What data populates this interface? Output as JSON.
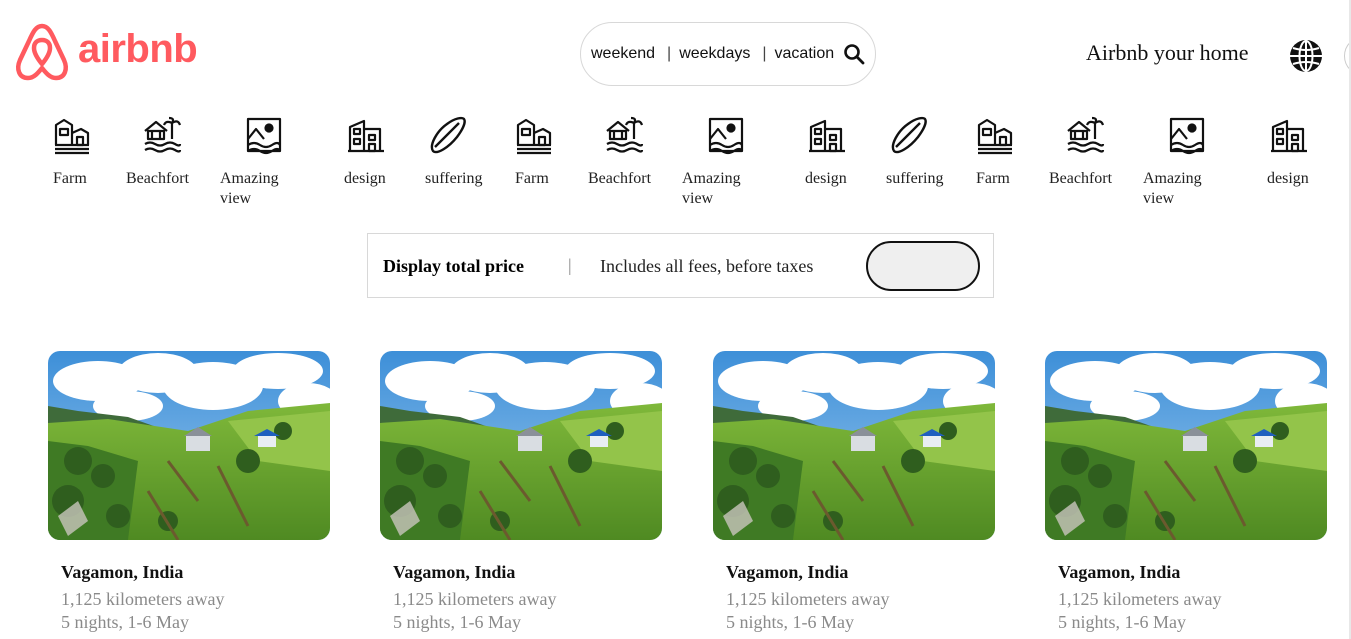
{
  "brand": {
    "name": "airbnb",
    "color": "#ff5a5f"
  },
  "search": {
    "segments": [
      "weekend",
      "weekdays",
      "vacation"
    ],
    "icon": "search-icon"
  },
  "header": {
    "host_label": "Airbnb your home",
    "globe_icon": "globe-icon"
  },
  "categories": [
    {
      "label": "Farm",
      "icon": "farm-icon"
    },
    {
      "label": "Beachfort",
      "icon": "beachfort-icon"
    },
    {
      "label": "Amazing view",
      "icon": "amazing-view-icon"
    },
    {
      "label": "design",
      "icon": "design-icon"
    },
    {
      "label": "suffering",
      "icon": "surfboard-icon"
    },
    {
      "label": "Farm",
      "icon": "farm-icon"
    },
    {
      "label": "Beachfort",
      "icon": "beachfort-icon"
    },
    {
      "label": "Amazing view",
      "icon": "amazing-view-icon"
    },
    {
      "label": "design",
      "icon": "design-icon"
    },
    {
      "label": "suffering",
      "icon": "surfboard-icon"
    },
    {
      "label": "Farm",
      "icon": "farm-icon"
    },
    {
      "label": "Beachfort",
      "icon": "beachfort-icon"
    },
    {
      "label": "Amazing view",
      "icon": "amazing-view-icon"
    },
    {
      "label": "design",
      "icon": "design-icon"
    }
  ],
  "price_toggle": {
    "title": "Display total price",
    "separator": "|",
    "subtitle": "Includes all fees, before taxes",
    "enabled": false
  },
  "listings": [
    {
      "title": "Vagamon, India",
      "distance": "1,125 kilometers away",
      "dates": "5 nights, 1-6 May"
    },
    {
      "title": "Vagamon, India",
      "distance": "1,125 kilometers away",
      "dates": "5 nights, 1-6 May"
    },
    {
      "title": "Vagamon, India",
      "distance": "1,125 kilometers away",
      "dates": "5 nights, 1-6 May"
    },
    {
      "title": "Vagamon, India",
      "distance": "1,125 kilometers away",
      "dates": "5 nights, 1-6 May"
    }
  ]
}
